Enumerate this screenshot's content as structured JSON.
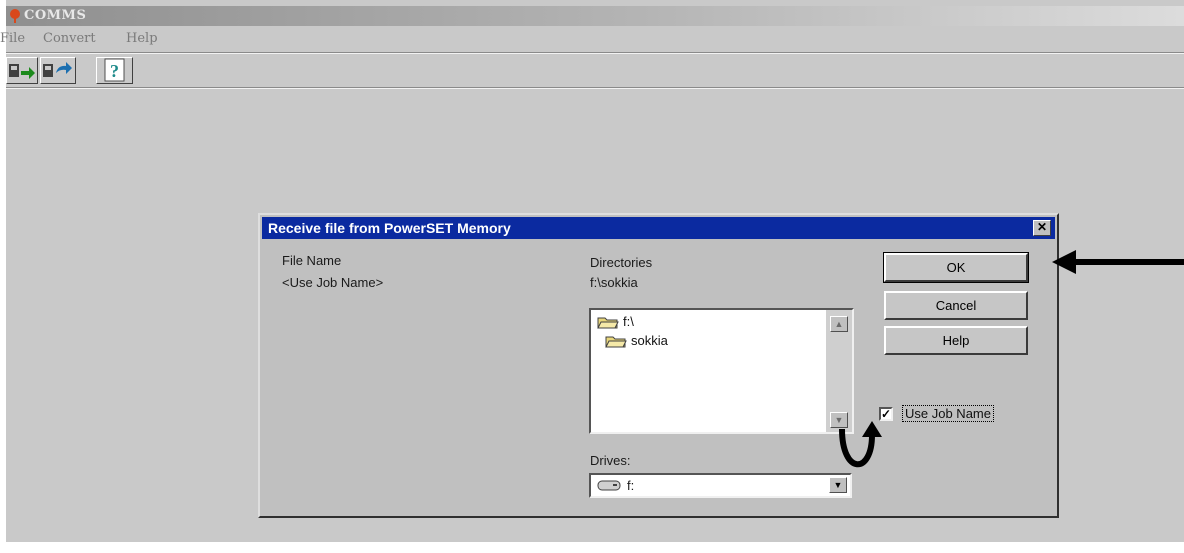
{
  "app": {
    "title": "COMMS",
    "menu": [
      "File",
      "Convert",
      "Help"
    ]
  },
  "toolbar": {
    "buttons": [
      "receive-file-icon",
      "send-file-icon",
      "help-icon"
    ]
  },
  "dialog": {
    "title": "Receive file from PowerSET Memory",
    "close_label": "✕",
    "file_name_label": "File Name",
    "file_name_value": "<Use Job Name>",
    "directories_label": "Directories",
    "current_dir": "f:\\sokkia",
    "dir_items": [
      "f:\\",
      "sokkia"
    ],
    "drives_label": "Drives:",
    "drive_value": "f:",
    "ok_label": "OK",
    "cancel_label": "Cancel",
    "help_label": "Help",
    "checkbox_label": "Use Job Name",
    "checkbox_checked": true
  },
  "colors": {
    "dialog_title_bg": "#0b2aa0",
    "face": "#c0c0c0"
  }
}
